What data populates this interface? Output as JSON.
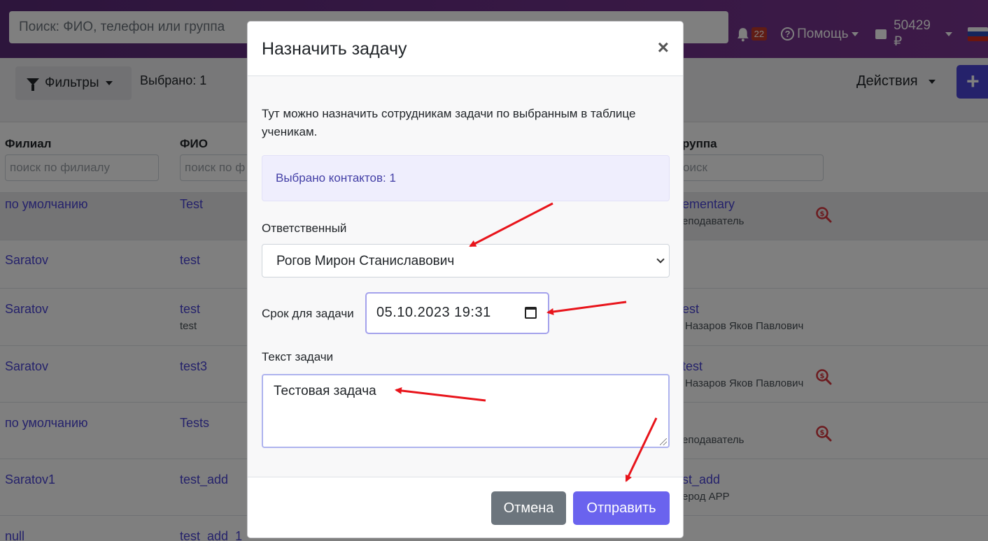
{
  "topbar": {
    "search_placeholder": "Поиск: ФИО, телефон или группа",
    "notifications_count": "22",
    "help_label": "Помощь",
    "balance": "50429 ₽"
  },
  "toolbar": {
    "filters_label": "Фильтры",
    "selected_label": "Выбрано: 1",
    "actions_label": "Действия",
    "add_label": "+"
  },
  "table": {
    "columns": {
      "branch": {
        "label": "Филиал",
        "placeholder": "поиск по филиалу"
      },
      "name": {
        "label": "ФИО",
        "placeholder": "поиск по ф"
      },
      "group": {
        "label": "руппа",
        "placeholder": "оиск"
      }
    },
    "rows": [
      {
        "branch": "по умолчанию",
        "name": "Test",
        "name_sub": "",
        "group": "ementary",
        "group_sub": "еподаватель"
      },
      {
        "branch": "Saratov",
        "name": "test",
        "name_sub": "",
        "group": "",
        "group_sub": ""
      },
      {
        "branch": "Saratov",
        "name": "test",
        "name_sub": "test",
        "group": "est",
        "group_sub": "Назаров Яков Павлович"
      },
      {
        "branch": "Saratov",
        "name": "test3",
        "name_sub": "",
        "group": "test",
        "group_sub": "Назаров Яков Павлович"
      },
      {
        "branch": "по умолчанию",
        "name": "Tests",
        "name_sub": "",
        "group": "",
        "group_sub": "еподаватель"
      },
      {
        "branch": "Saratov1",
        "name": "test_add",
        "name_sub": "",
        "group": "st_add",
        "group_sub": "eрод APP"
      },
      {
        "branch": "null",
        "name": "test_add_1",
        "name_sub": "",
        "group": "",
        "group_sub": ""
      }
    ]
  },
  "modal": {
    "title": "Назначить задачу",
    "close_label": "×",
    "description": "Тут можно назначить сотрудникам задачи по выбранным в таблице ученикам.",
    "selected_contacts": "Выбрано контактов: 1",
    "responsible_label": "Ответственный",
    "responsible_value": "Рогов Мирон Станиславович",
    "deadline_label": "Срок для задачи",
    "deadline_value": "05.10.2023 19:31",
    "task_text_label": "Текст задачи",
    "task_text_value": "Тестовая задача",
    "cancel_label": "Отмена",
    "send_label": "Отправить"
  },
  "colors": {
    "accent": "#6a63ee",
    "link": "#4a45d6",
    "annotation_arrow": "#e8141b",
    "money_search_icon": "#d9363e"
  },
  "icons": [
    "bell-icon",
    "help-icon",
    "wallet-icon",
    "flag-icon",
    "funnel-icon",
    "search-money-icon",
    "close-icon",
    "calendar-icon",
    "chevron-down-icon"
  ]
}
